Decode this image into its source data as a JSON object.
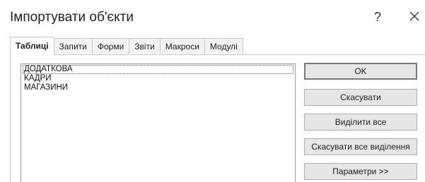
{
  "dialog": {
    "title": "Імпортувати об'єкти",
    "help_glyph": "?"
  },
  "tabs": [
    {
      "label": "Таблиці",
      "active": true
    },
    {
      "label": "Запити",
      "active": false
    },
    {
      "label": "Форми",
      "active": false
    },
    {
      "label": "Звіти",
      "active": false
    },
    {
      "label": "Макроси",
      "active": false
    },
    {
      "label": "Модулі",
      "active": false
    }
  ],
  "tables": [
    "ДОДАТКОВА",
    "КАДРИ",
    "МАГАЗИНИ"
  ],
  "buttons": {
    "ok": "OK",
    "cancel": "Скасувати",
    "select_all": "Виділити все",
    "deselect_all": "Скасувати все виділення",
    "options": "Параметри >>"
  },
  "icons": {
    "help": "help-icon",
    "close": "close-icon"
  }
}
